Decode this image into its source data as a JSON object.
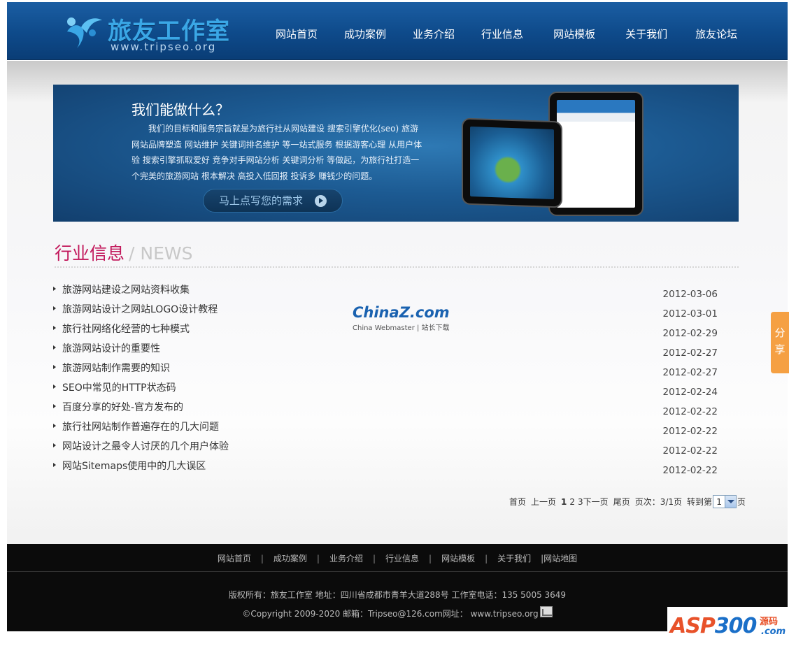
{
  "header": {
    "logo_title": "旅友工作室",
    "logo_sub": "www.tripseo.org",
    "nav": [
      "网站首页",
      "成功案例",
      "业务介绍",
      "行业信息",
      "网站模板",
      "关于我们",
      "旅友论坛"
    ]
  },
  "banner": {
    "title": "我们能做什么？",
    "text": "我们的目标和服务宗旨就是为旅行社从网站建设 搜索引擎优化(seo) 旅游网站品牌塑造 网站维护 关键词排名维护 等一站式服务 根据游客心理 从用户体验 搜索引擎抓取爱好 竞争对手网站分析 关键词分析 等做起，为旅行社打造一个完美的旅游网站 根本解决 高投入低回报 投诉多 赚钱少的问题。",
    "button": "马上点写您的需求"
  },
  "news": {
    "heading_cn": "行业信息",
    "heading_en": "/ NEWS",
    "items": [
      {
        "title": "旅游网站建设之网站资料收集",
        "date": "2012-03-06"
      },
      {
        "title": "旅游网站设计之网站LOGO设计教程",
        "date": "2012-03-01"
      },
      {
        "title": "旅行社网络化经营的七种模式",
        "date": "2012-02-29"
      },
      {
        "title": "旅游网站设计的重要性",
        "date": "2012-02-27"
      },
      {
        "title": "旅游网站制作需要的知识",
        "date": "2012-02-27"
      },
      {
        "title": "SEO中常见的HTTP状态码",
        "date": "2012-02-24"
      },
      {
        "title": "百度分享的好处-官方发布的",
        "date": "2012-02-22"
      },
      {
        "title": "旅行社网站制作普遍存在的几大问题",
        "date": "2012-02-22"
      },
      {
        "title": "网站设计之最令人讨厌的几个用户体验",
        "date": "2012-02-22"
      },
      {
        "title": "网站Sitemaps使用中的几大误区",
        "date": "2012-02-22"
      }
    ]
  },
  "watermark": {
    "logo_a": "China",
    "logo_z": "Z",
    "logo_b": ".com",
    "sub": "China Webmaster | 站长下载"
  },
  "pager": {
    "first": "首页",
    "prev": "上一页",
    "page1": "1",
    "page2": "2",
    "page3": "3",
    "next": "下一页",
    "last": "尾页",
    "info": "页次：3/1页",
    "goto_prefix": "转到第",
    "goto_value": "1",
    "goto_suffix": "页"
  },
  "footer": {
    "nav": [
      "网站首页",
      "成功案例",
      "业务介绍",
      "行业信息",
      "网站模板",
      "关于我们"
    ],
    "sitemap": "|网站地图",
    "line1": "版权所有：旅友工作室  地址：四川省成都市青羊大道288号  工作室电话：135 5005 3649",
    "line2": "©Copyright 2009-2020 邮箱：Tripseo@126.com网址：  www.tripseo.org"
  },
  "share": {
    "label_1": "分",
    "label_2": "享"
  },
  "corner": {
    "a": "ASP",
    "b": "300",
    "yuan": "源码",
    "com": ".com"
  },
  "colors": {
    "header": "#0e4a8a",
    "news_heading": "#c2185b",
    "footer": "#0b0b0b",
    "share_tab": "#f5a043"
  },
  "icons": [
    "logo-mark-icon",
    "arrow-circle-icon",
    "bullet-icon",
    "dropdown-arrow-icon",
    "stat-chart-icon"
  ]
}
